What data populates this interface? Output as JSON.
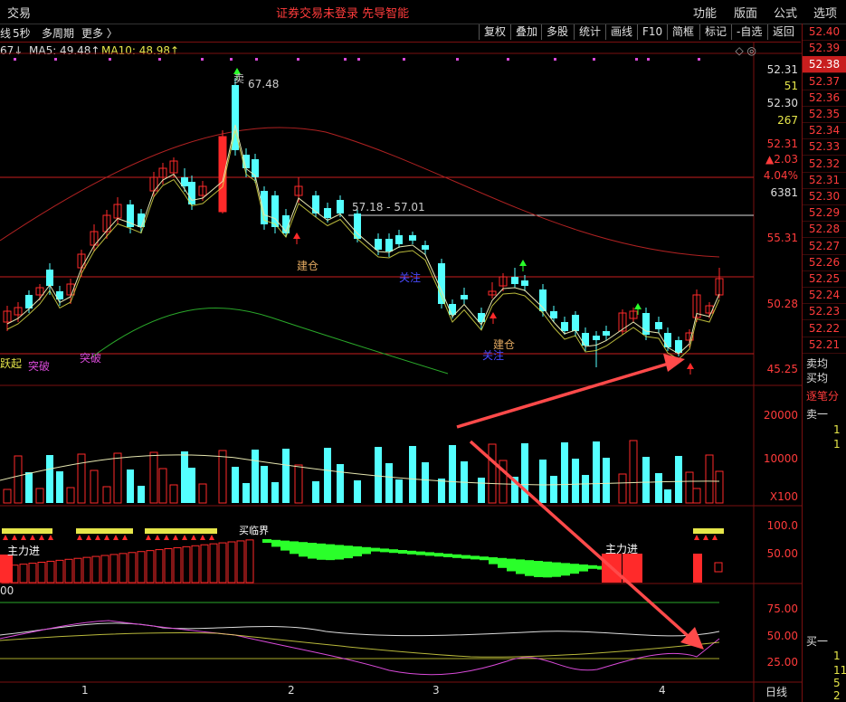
{
  "topbar": {
    "left": "交易",
    "center": "证券交易未登录  先导智能",
    "menu": [
      "功能",
      "版面",
      "公式",
      "选项"
    ]
  },
  "toolbar": {
    "left": [
      "线",
      "5秒",
      "多周期",
      "更多 〉"
    ],
    "buttons": [
      "复权",
      "叠加",
      "多股",
      "统计",
      "画线",
      "F10",
      "简框",
      "标记",
      "-自选",
      "返回"
    ]
  },
  "legend": {
    "ma_prefix": "67↓",
    "ma5": "MA5: 49.48↑",
    "ma10": "MA10: 48.98↑"
  },
  "annotations": {
    "high": "67.48",
    "range": "57.18 - 57.01",
    "sell": "卖",
    "jiancang1": "建仓",
    "jiancang2": "建仓",
    "guanzhu1": "关注",
    "guanzhu2": "关注",
    "tupo1": "突破",
    "tupo2": "突破",
    "yueqi": "跃起",
    "zhuli1": "主力进",
    "zhuli2": "主力进",
    "maimai": "买临界"
  },
  "yaxis": {
    "price": [
      "55.31",
      "50.28",
      "45.25"
    ],
    "volume": [
      "20000",
      "10000",
      "X100"
    ],
    "ind1": [
      "100.0",
      "50.00"
    ],
    "ind2": [
      "75.00",
      "50.00",
      "25.00"
    ],
    "ind1_left": "00"
  },
  "right_info": {
    "p1": "52.31",
    "p2": "51",
    "p3": "52.30",
    "p4": "267",
    "p5": "52.31",
    "p6": "▲2.03",
    "p7": "4.04%",
    "p8": "6381",
    "icons": "◇ ◎"
  },
  "price_ladder": [
    "52.40",
    "52.39",
    "52.38",
    "52.37",
    "52.36",
    "52.35",
    "52.34",
    "52.33",
    "52.32",
    "52.31",
    "52.30",
    "52.29",
    "52.28",
    "52.27",
    "52.26",
    "52.25",
    "52.24",
    "52.23",
    "52.22",
    "52.21"
  ],
  "price_ladder_selected": "52.38",
  "side": {
    "sell_avg": "卖均",
    "buy_avg": "买均",
    "tick": "逐笔分",
    "sell1": "卖一",
    "s1": "1",
    "s2": "1",
    "buy1": "买一",
    "b1": "1",
    "b2": "11",
    "b3": "5",
    "b4": "2"
  },
  "xaxis": {
    "labels": [
      "1",
      "2",
      "3",
      "4"
    ],
    "daily": "日线"
  },
  "colors": {
    "up": "#ff2a2a",
    "down": "#54ffff",
    "bg": "#000000",
    "frame": "#7a1010"
  }
}
